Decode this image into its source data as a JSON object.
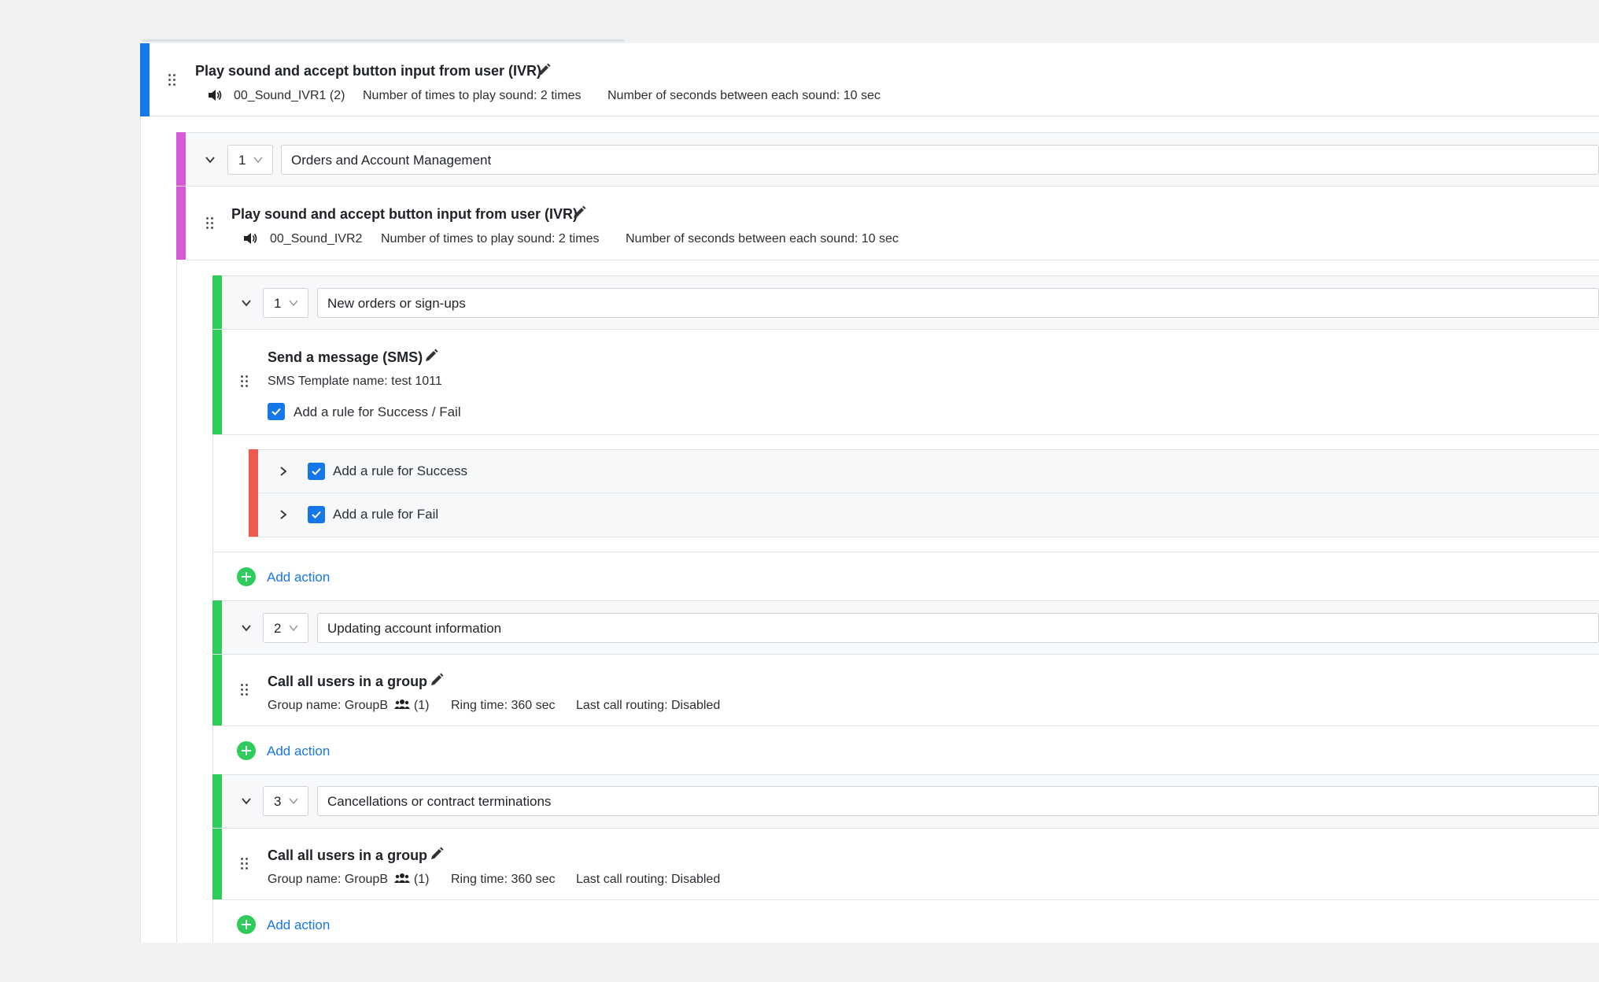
{
  "ivr_top": {
    "title": "Play sound and accept button input from user (IVR)",
    "sound": "00_Sound_IVR1 (2)",
    "play_times_label": "Number of times to play sound:",
    "play_times_value": "2 times",
    "seconds_label": "Number of seconds between each sound:",
    "seconds_value": "10 sec"
  },
  "branch_1": {
    "number": "1",
    "name": "Orders and Account Management",
    "ivr": {
      "title": "Play sound and accept button input from user (IVR)",
      "sound": "00_Sound_IVR2",
      "play_times_label": "Number of times to play sound:",
      "play_times_value": "2 times",
      "seconds_label": "Number of seconds between each sound:",
      "seconds_value": "10 sec"
    }
  },
  "sub_branches": [
    {
      "number": "1",
      "name": "New orders or sign-ups",
      "action_title": "Send a message (SMS)",
      "template_label": "SMS Template name:",
      "template_value": "test 1011",
      "rule_checkbox_label": "Add a rule for Success / Fail",
      "rules": [
        "Add a rule for Success",
        "Add a rule for Fail"
      ],
      "add_action": "Add action"
    },
    {
      "number": "2",
      "name": "Updating account information",
      "action_title": "Call all users in a group",
      "group_label": "Group name:",
      "group_value": "GroupB",
      "group_count": "(1)",
      "ring_label": "Ring time:",
      "ring_value": "360 sec",
      "routing_label": "Last call routing:",
      "routing_value": "Disabled",
      "add_action": "Add action"
    },
    {
      "number": "3",
      "name": "Cancellations or contract terminations",
      "action_title": "Call all users in a group",
      "group_label": "Group name:",
      "group_value": "GroupB",
      "group_count": "(1)",
      "ring_label": "Ring time:",
      "ring_value": "360 sec",
      "routing_label": "Last call routing:",
      "routing_value": "Disabled",
      "add_action": "Add action"
    }
  ],
  "icons": [
    "drag-handle-icon",
    "pencil-icon",
    "speaker-icon",
    "chevron-down-icon",
    "chevron-right-icon",
    "check-icon",
    "users-icon",
    "plus-circle-icon"
  ],
  "colors": {
    "blue_bar": "#1677e8",
    "pink_bar": "#d65ad6",
    "green_bar": "#2ecc5a",
    "red_bar": "#ee5a4f",
    "link": "#1677e8",
    "page_bg": "#f1f2f4"
  }
}
